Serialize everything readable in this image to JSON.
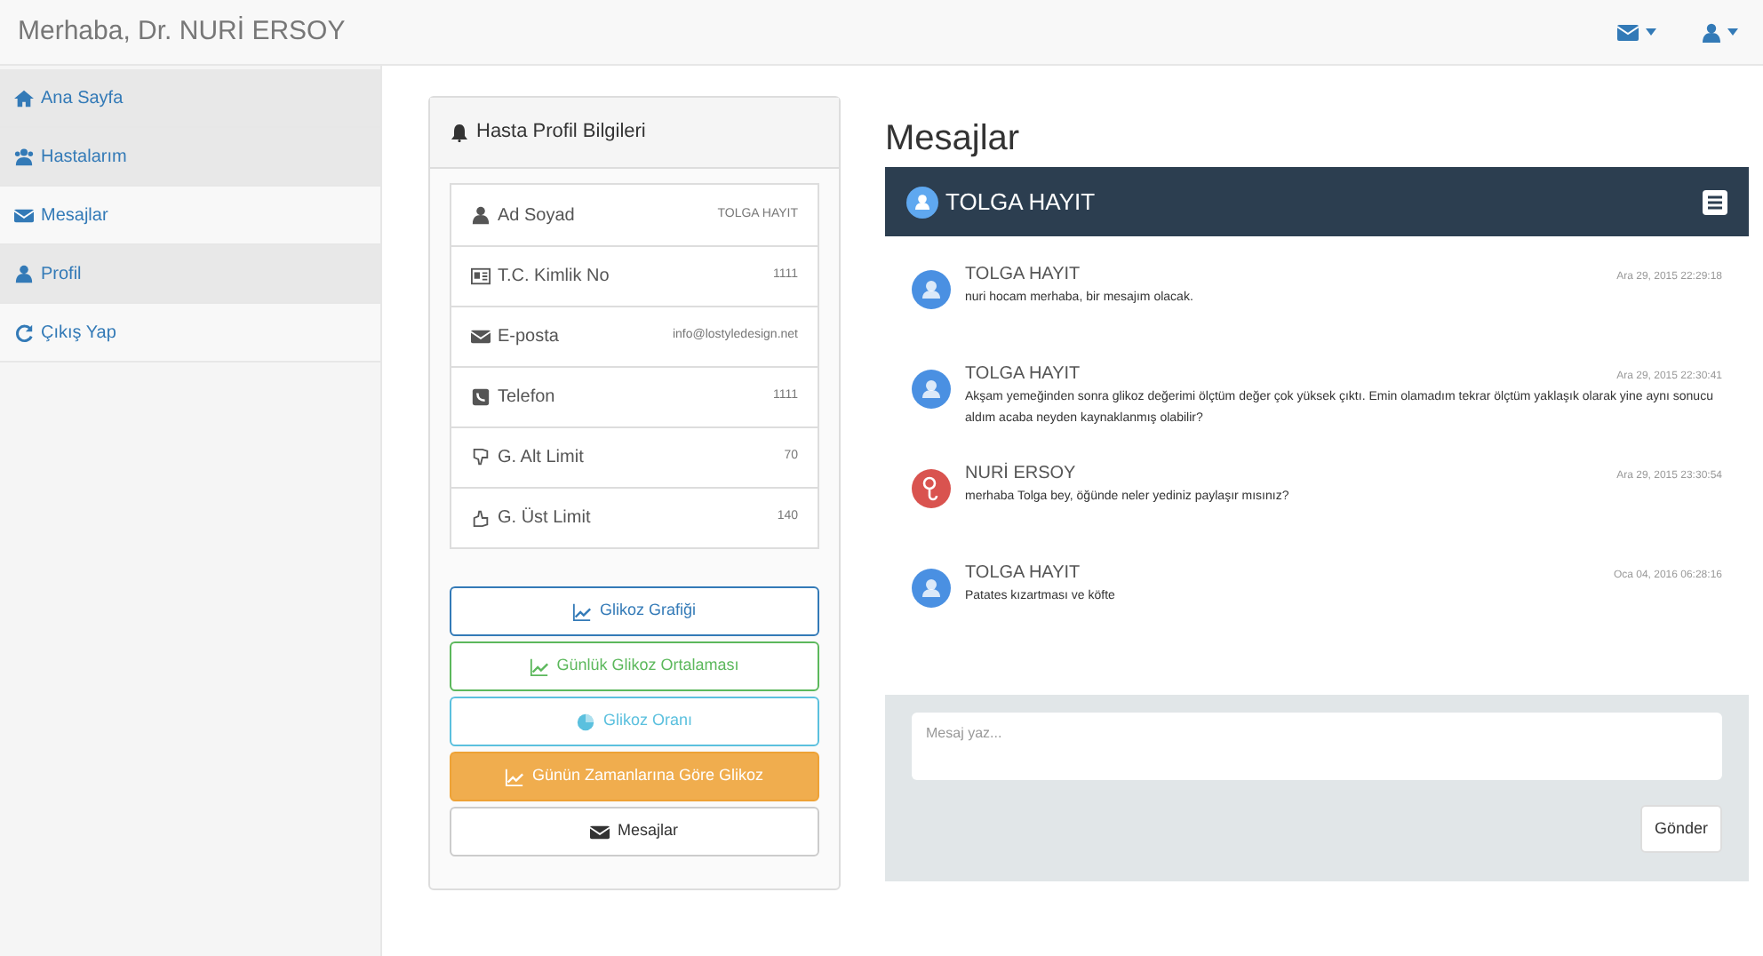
{
  "navbar": {
    "greeting": "Merhaba, Dr. NURİ ERSOY"
  },
  "sidebar": {
    "items": [
      {
        "label": "Ana Sayfa",
        "highlighted": true
      },
      {
        "label": "Hastalarım",
        "highlighted": true
      },
      {
        "label": "Mesajlar",
        "highlighted": false
      },
      {
        "label": "Profil",
        "highlighted": true
      },
      {
        "label": "Çıkış Yap",
        "highlighted": false
      }
    ]
  },
  "profile_panel": {
    "title": "Hasta Profil Bilgileri",
    "fields": [
      {
        "label": "Ad Soyad",
        "value": "TOLGA HAYIT"
      },
      {
        "label": "T.C. Kimlik No",
        "value": "1111"
      },
      {
        "label": "E-posta",
        "value": "info@lostyledesign.net"
      },
      {
        "label": "Telefon",
        "value": "1111"
      },
      {
        "label": "G. Alt Limit",
        "value": "70"
      },
      {
        "label": "G. Üst Limit",
        "value": "140"
      }
    ],
    "buttons": [
      {
        "kind": "primary",
        "label": "Glikoz Grafiği"
      },
      {
        "kind": "success",
        "label": "Günlük Glikoz Ortalaması"
      },
      {
        "kind": "info",
        "label": "Glikoz Oranı"
      },
      {
        "kind": "warning",
        "label": "Günün Zamanlarına Göre Glikoz"
      },
      {
        "kind": "default",
        "label": "Mesajlar"
      }
    ]
  },
  "messages": {
    "title": "Mesajlar",
    "chat_header": "TOLGA HAYIT",
    "items": [
      {
        "sender": "TOLGA HAYIT",
        "kind": "patient",
        "time": "Ara 29, 2015 22:29:18",
        "text": "nuri hocam merhaba, bir mesajım olacak."
      },
      {
        "sender": "TOLGA HAYIT",
        "kind": "patient",
        "time": "Ara 29, 2015 22:30:41",
        "text": "Akşam yemeğinden sonra glikoz değerimi ölçtüm değer çok yüksek çıktı. Emin olamadım tekrar ölçtüm yaklaşık olarak yine aynı sonucu aldım acaba neyden kaynaklanmış olabilir?"
      },
      {
        "sender": "NURİ ERSOY",
        "kind": "doctor",
        "time": "Ara 29, 2015 23:30:54",
        "text": "merhaba Tolga bey, öğünde neler yediniz paylaşır mısınız?"
      },
      {
        "sender": "TOLGA HAYIT",
        "kind": "patient",
        "time": "Oca 04, 2016 06:28:16",
        "text": "Patates kızartması ve köfte"
      }
    ],
    "input": {
      "placeholder": "Mesaj yaz..."
    },
    "send_button": "Gönder"
  }
}
